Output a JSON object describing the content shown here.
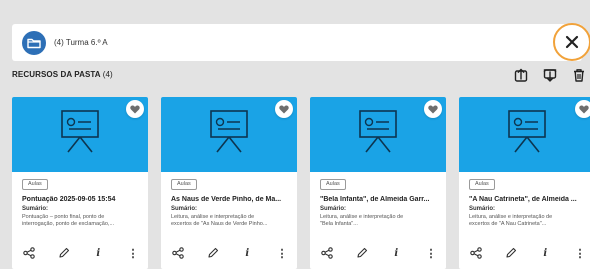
{
  "folder": {
    "name": "(4) Turma 6.º A",
    "icon": "folder-icon"
  },
  "close": {
    "icon": "close-icon"
  },
  "section": {
    "title": "RECURSOS DA PASTA",
    "count": "(4)"
  },
  "toolbar": {
    "icons": [
      "upload-icon",
      "download-icon",
      "trash-icon"
    ]
  },
  "colors": {
    "thumbnail": "#1aa3e6",
    "accent_ring": "#f1a23a",
    "folder": "#2d6fb6"
  },
  "cards": [
    {
      "tag": "Aulas",
      "title": "Pontuação 2025-09-05 15:54",
      "summary_label": "Sumário:",
      "summary_line1": "Pontuação – ponto final, ponto de",
      "summary_line2": "interrogação, ponto de exclamação,..."
    },
    {
      "tag": "Aulas",
      "title": "As Naus de Verde Pinho, de Ma...",
      "summary_label": "Sumário:",
      "summary_line1": "Leitura, análise e interpretação de",
      "summary_line2": "excertos de \"As Naus de Verde Pinho..."
    },
    {
      "tag": "Aulas",
      "title": "\"Bela Infanta\", de Almeida Garr...",
      "summary_label": "Sumário:",
      "summary_line1": "Leitura, análise e interpretação de",
      "summary_line2": "\"Bela Infanta\"..."
    },
    {
      "tag": "Aulas",
      "title": "\"A Nau Catrineta\", de Almeida ...",
      "summary_label": "Sumário:",
      "summary_line1": "Leitura, análise e interpretação de",
      "summary_line2": "excertos de \"A Nau Catrineta\"..."
    }
  ],
  "card_action_icons": [
    "share-icon",
    "edit-icon",
    "info-icon",
    "more-icon"
  ],
  "card_info_glyph": "i",
  "card_more_glyph": "⋮"
}
